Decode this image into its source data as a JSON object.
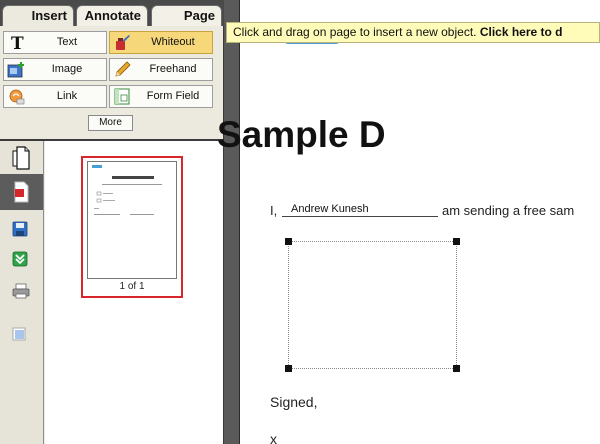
{
  "tabs": [
    {
      "label": "Insert",
      "active": true
    },
    {
      "label": "Annotate",
      "active": false
    },
    {
      "label": "Page",
      "active": false
    }
  ],
  "tools": [
    {
      "label": "Text",
      "icon": "text-T-icon"
    },
    {
      "label": "Whiteout",
      "icon": "whiteout-icon",
      "selected": true
    },
    {
      "label": "Image",
      "icon": "image-icon"
    },
    {
      "label": "Freehand",
      "icon": "pencil-icon"
    },
    {
      "label": "Link",
      "icon": "link-icon"
    },
    {
      "label": "Form Field",
      "icon": "form-field-icon"
    }
  ],
  "more_label": "More",
  "thumbnail": {
    "page_label": "1 of 1"
  },
  "hint": {
    "text": "Click and drag on page to insert a new object.",
    "link": "Click here to d"
  },
  "document": {
    "title": "Sample D",
    "line_prefix": "I,",
    "name_value": "Andrew Kunesh",
    "line_suffix": "am sending a free sam",
    "signed": "Signed,",
    "x_mark": "x"
  },
  "colors": {
    "selected_tool": "#f6d77a",
    "thumb_border": "#d9262b",
    "hint_bg": "#fffbb8",
    "accent_blue": "#4a9ed6"
  }
}
